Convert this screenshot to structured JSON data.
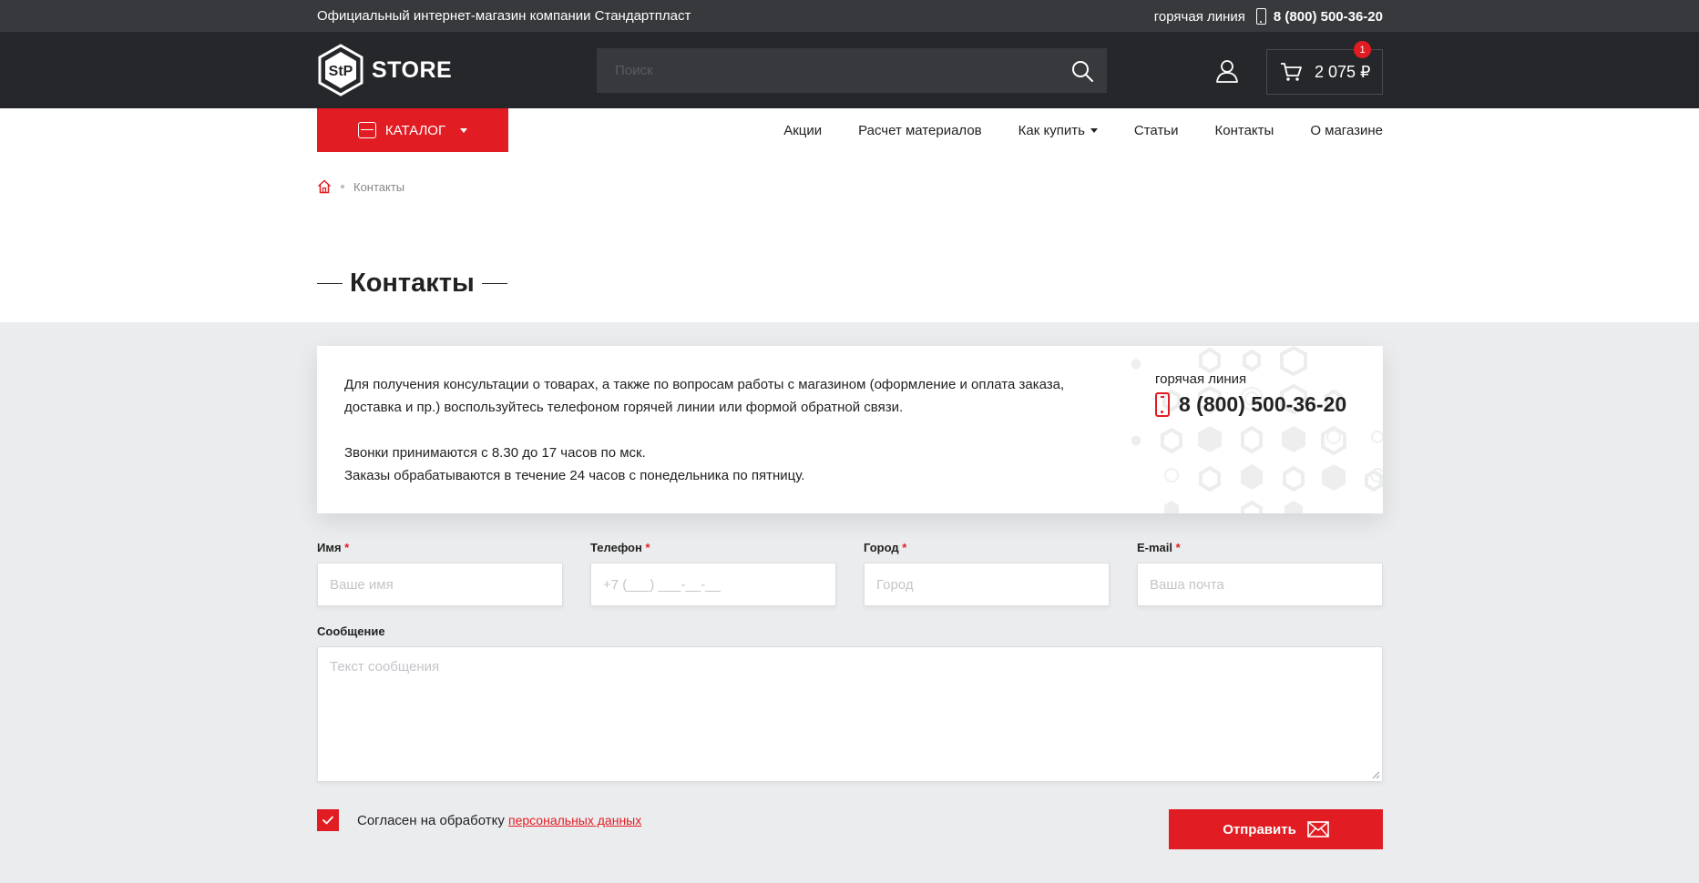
{
  "topbar": {
    "tagline": "Официальный интернет-магазин компании Стандартпласт",
    "hotline_label": "горячая линия",
    "hotline_phone": "8 (800) 500-36-20"
  },
  "header": {
    "logo_mark": "StP",
    "logo_text": "STORE",
    "search_placeholder": "Поиск",
    "cart_total": "2 075 ₽",
    "cart_count": "1"
  },
  "nav": {
    "catalog_label": "КАТАЛОГ",
    "items": [
      {
        "label": "Акции"
      },
      {
        "label": "Расчет материалов"
      },
      {
        "label": "Как купить",
        "has_dropdown": true
      },
      {
        "label": "Статьи"
      },
      {
        "label": "Контакты"
      },
      {
        "label": "О магазине"
      }
    ]
  },
  "breadcrumb": {
    "current": "Контакты"
  },
  "page": {
    "title": "Контакты"
  },
  "info": {
    "paragraph1": "Для получения консультации о товарах, а также по вопросам работы с магазином (оформление и оплата заказа, доставка и пр.) воспользуйтесь телефоном горячей линии или формой обратной связи.",
    "line2": "Звонки принимаются с 8.30 до 17 часов по мск.",
    "line3": "Заказы обрабатываются в течение 24 часов с понедельника по пятницу.",
    "hotline_label": "горячая линия",
    "hotline_phone": "8 (800) 500-36-20"
  },
  "form": {
    "name_label": "Имя",
    "name_placeholder": "Ваше имя",
    "phone_label": "Телефон",
    "phone_placeholder": "+7 (___) ___-__-__",
    "city_label": "Город",
    "city_placeholder": "Город",
    "email_label": "E-mail",
    "email_placeholder": "Ваша почта",
    "required_mark": "*",
    "message_label": "Сообщение",
    "message_placeholder": "Текст сообщения",
    "agree_text": "Согласен на обработку",
    "agree_link": "персональных данных",
    "submit_label": "Отправить"
  },
  "colors": {
    "accent": "#e21c23",
    "dark": "#26272a",
    "topbar": "#38393c",
    "page_bg": "#ebecee"
  }
}
